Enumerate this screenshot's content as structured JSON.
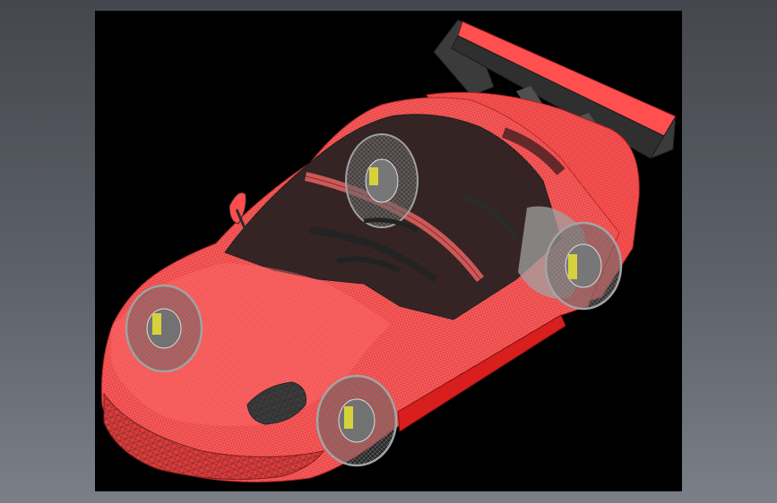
{
  "viewport": {
    "background": "#000000",
    "render_mode": "wireframe-shaded"
  },
  "model": {
    "body_color": "#ff4d4d",
    "body_dark_color": "#d62020",
    "wireframe_color": "#3a3a3a",
    "wheel_color": "#9a9a9a",
    "brake_caliper_color": "#d7d23c",
    "wing_color": "#3b3b3b",
    "wing_top_color": "#ff4f4f"
  },
  "icons": {
    "model": "car-model-icon",
    "wheel": "wheel-icon",
    "wing": "rear-wing-icon",
    "mirror": "mirror-icon"
  }
}
